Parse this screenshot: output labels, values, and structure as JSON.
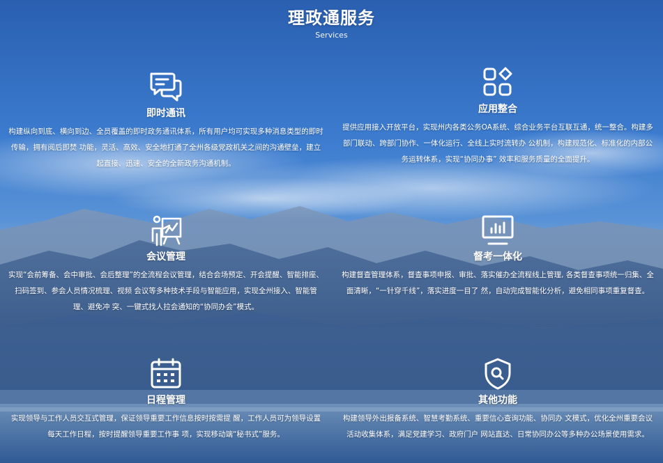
{
  "header": {
    "title": "理政通服务",
    "subtitle": "Services"
  },
  "services": [
    {
      "icon": "chat-bubbles-icon",
      "title": "即时通讯",
      "description": "构建纵向到底、横向到边、全员覆盖的即时政务通讯体系，所有用户均可实现多种消息类型的即时传输，拥有阅后即焚 功能，灵活、高效、安全地打通了全州各级党政机关之间的沟通壁垒，建立起直接、迅速、安全的全新政务沟通机制。"
    },
    {
      "icon": "app-grid-icon",
      "title": "应用整合",
      "description": "提供应用接入开放平台，实现州内各类公务OA系统、综合业务平台互联互通，统一整合。构建多部门联动、跨部门协作、一体化运行、全线上实时流转办 公机制，构建规范化、标准化的内部公务运转体系，实现“协同办事” 效率和服务质量的全面提升。"
    },
    {
      "icon": "presentation-icon",
      "title": "会议管理",
      "description": "实现“会前筹备、会中审批、会后整理”的全流程会议管理，结合会场预定、开会提醒、智能排座、扫码签到、参会人员情况梳理、视频 会议等多种技术手段与智能应用，实现全州接入、智能管理、避免冲 突、一键式找人拉会通知的“协同办会”模式。"
    },
    {
      "icon": "monitor-chart-icon",
      "title": "督考一体化",
      "description": "构建督查管理体系，督查事项申报、审批、落实催办全流程线上管理, 各类督查事项统一归集、全面清晰，“一针穿千线”，落实进度一目了 然，自动完成智能化分析，避免相同事项重复督查。"
    },
    {
      "icon": "calendar-icon",
      "title": "日程管理",
      "description": "实现领导与工作人员交互式管理，保证领导重要工作信息按时按需提 醒，工作人员可为领导设置每天工作日程，按时提醒领导重要工作事 项，实现移动端“秘书式”服务。"
    },
    {
      "icon": "shield-search-icon",
      "title": "其他功能",
      "description": "构建领导外出报备系统、智慧考勤系统、重要信心查询功能、协同办 文模式，优化全州重要会议活动收集体系，满足党建学习、政府门户 网站直达、日常协同办公等多种办公场景使用需求。"
    }
  ]
}
